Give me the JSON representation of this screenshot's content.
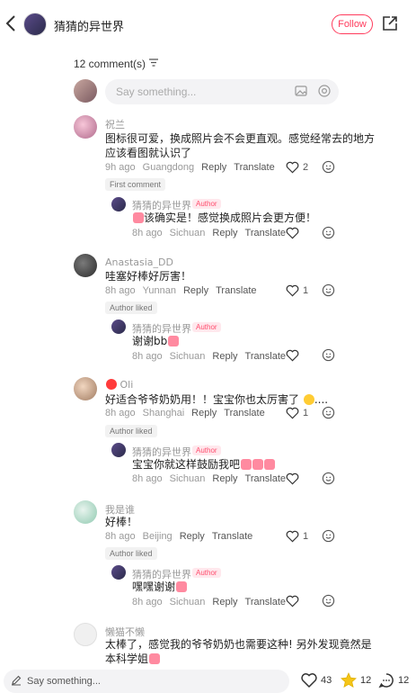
{
  "header": {
    "back_icon": "chevron-left-icon",
    "author_name": "猜猜的异世界",
    "follow_label": "Follow",
    "share_icon": "share-icon"
  },
  "comments_header": {
    "count_label": "12 comment(s)",
    "sort_icon": "sort-icon"
  },
  "comment_input": {
    "placeholder": "Say something...",
    "image_icon": "image-icon",
    "mention_icon": "at-icon"
  },
  "actions": {
    "reply": "Reply",
    "translate": "Translate"
  },
  "comments": [
    {
      "user": "祝兰",
      "text_line1": "图标很可爱，换成照片会不会更直观。感觉经常去的地方",
      "text_line2": "应该看图就认识了",
      "time": "9h ago",
      "location": "Guangdong",
      "likes": "2",
      "tag": "First comment",
      "reply": {
        "user": "猜猜的异世界",
        "author_tag": "Author",
        "text": "该确实是！感觉换成照片会更方便！",
        "time": "8h ago",
        "location": "Sichuan"
      }
    },
    {
      "user": "Anastasia_DD",
      "text": "哇塞好棒好厉害！",
      "time": "8h ago",
      "location": "Yunnan",
      "likes": "1",
      "tag": "Author liked",
      "reply": {
        "user": "猜猜的异世界",
        "author_tag": "Author",
        "text": "谢谢bb",
        "time": "8h ago",
        "location": "Sichuan"
      }
    },
    {
      "user": "Oli",
      "text": "好适合爷爷奶奶用！！宝宝你也太厉害了",
      "text_tail": "....",
      "time": "8h ago",
      "location": "Shanghai",
      "likes": "1",
      "tag": "Author liked",
      "reply": {
        "user": "猜猜的异世界",
        "author_tag": "Author",
        "text": "宝宝你就这样鼓励我吧",
        "time": "8h ago",
        "location": "Sichuan"
      }
    },
    {
      "user": "我是谁",
      "text": "好棒！",
      "time": "8h ago",
      "location": "Beijing",
      "likes": "1",
      "tag": "Author liked",
      "reply": {
        "user": "猜猜的异世界",
        "author_tag": "Author",
        "text": "嘿嘿谢谢",
        "time": "8h ago",
        "location": "Sichuan"
      }
    },
    {
      "user": "懒猫不懒",
      "text_line1": "太棒了，感觉我的爷爷奶奶也需要这种! 另外发现竟然是",
      "text_line2": "本科学姐"
    }
  ],
  "bottom_bar": {
    "placeholder": "Say something...",
    "likes": "43",
    "stars": "12",
    "comments": "12"
  },
  "colors": {
    "accent": "#ff3b5c",
    "author_tag_bg": "#ffe8ed"
  }
}
